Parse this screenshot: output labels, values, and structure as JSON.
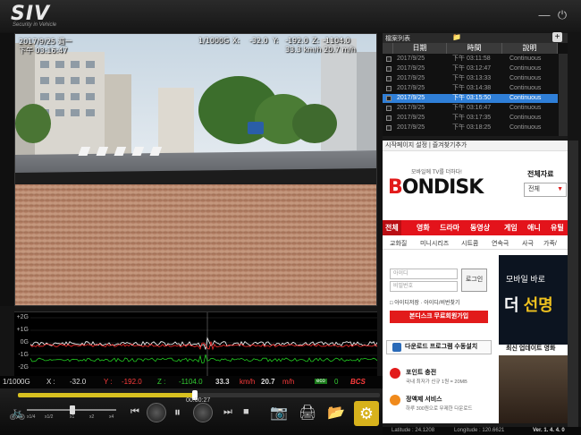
{
  "app": {
    "logo": "SIV",
    "tagline": "Security in Vehicle",
    "min_icon": "minimize-icon",
    "power_icon": "power-icon"
  },
  "video": {
    "date": "2017/9/25 週一",
    "time": "下午 03:16:47",
    "gsensor": "1/1000G",
    "x_label": "X:",
    "x_val": "-32.0",
    "y_label": "Y:",
    "y_val": "-192.0",
    "z_label": "Z:",
    "z_val": "-1104.0",
    "speed": "33.3 km/h 20.7 m/h"
  },
  "graph": {
    "labels": [
      "+2G",
      "+1G",
      "0G",
      "-1G",
      "-2G"
    ],
    "series_colors": {
      "x": "#ffffff",
      "y": "#ff2a2a",
      "z": "#22cc22"
    }
  },
  "sensor": {
    "unit": "1/1000G",
    "x_label": "X :",
    "x_val": "-32.0",
    "y_label": "Y :",
    "y_val": "-192.0",
    "z_label": "Z :",
    "z_val": "-1104.0",
    "speed_kmh": "33.3",
    "kmh_unit": "km/h",
    "speed_mph": "20.7",
    "mph_unit": "m/h",
    "eco_badge": "eco",
    "eco_val": "0",
    "brand_badge": "BCS"
  },
  "controls": {
    "time": "00:00:27",
    "progress": 0.49,
    "speeds": [
      "x1/4",
      "x1/2",
      "x1",
      "x2",
      "x4"
    ]
  },
  "file_list": {
    "title": "檔案列表",
    "columns": [
      "日期",
      "時間",
      "說明"
    ],
    "rows": [
      {
        "date": "2017/9/25",
        "time": "下午 03:11:58",
        "desc": "Continuous",
        "selected": false
      },
      {
        "date": "2017/9/25",
        "time": "下午 03:12:47",
        "desc": "Continuous",
        "selected": false
      },
      {
        "date": "2017/9/25",
        "time": "下午 03:13:33",
        "desc": "Continuous",
        "selected": false
      },
      {
        "date": "2017/9/25",
        "time": "下午 03:14:38",
        "desc": "Continuous",
        "selected": false
      },
      {
        "date": "2017/9/25",
        "time": "下午 03:15:50",
        "desc": "Continuous",
        "selected": true
      },
      {
        "date": "2017/9/25",
        "time": "下午 03:16:47",
        "desc": "Continuous",
        "selected": false
      },
      {
        "date": "2017/9/25",
        "time": "下午 03:17:35",
        "desc": "Continuous",
        "selected": false
      },
      {
        "date": "2017/9/25",
        "time": "下午 03:18:25",
        "desc": "Continuous",
        "selected": false
      }
    ]
  },
  "browser": {
    "toolbar": "시작페이지 설정 | 즐겨찾기추가",
    "slogan": "모바일에 TV를 더하다!",
    "logo_b": "B",
    "logo_rest": "ONDISK",
    "all_title": "전체자료",
    "all_select": "전체",
    "nav": [
      "전체",
      "영화",
      "드라마",
      "동영상",
      "게임",
      "애니",
      "유틸"
    ],
    "subnav": [
      "교화질",
      "미니시리즈",
      "시트콤",
      "연속극",
      "사극",
      "가족/"
    ],
    "id_placeholder": "아이디",
    "pw_placeholder": "비밀번호",
    "login": "로그인",
    "login_checks": "□ 아이디저장 · 아이디/비번찾기",
    "join": "본디스크 무료회원가입",
    "ad_line1": "모바일 바로",
    "ad_line2a": "더 ",
    "ad_line2b": "선명",
    "download": "다운로드 프로그램 수동설치",
    "recent": "최신 업데이트 영화",
    "promo1_title": "포인트 충전",
    "promo1_sub": "국내 최저가 신규 1원 = 20MB",
    "promo2_title": "정액제 서비스",
    "promo2_sub": "하루 300원으로 무제한 다운로드"
  },
  "status": {
    "lat": "Latitude : 24.1208",
    "lon": "Longitude : 120.6621",
    "ver": "Ver. 1. 4. 4. 0"
  }
}
